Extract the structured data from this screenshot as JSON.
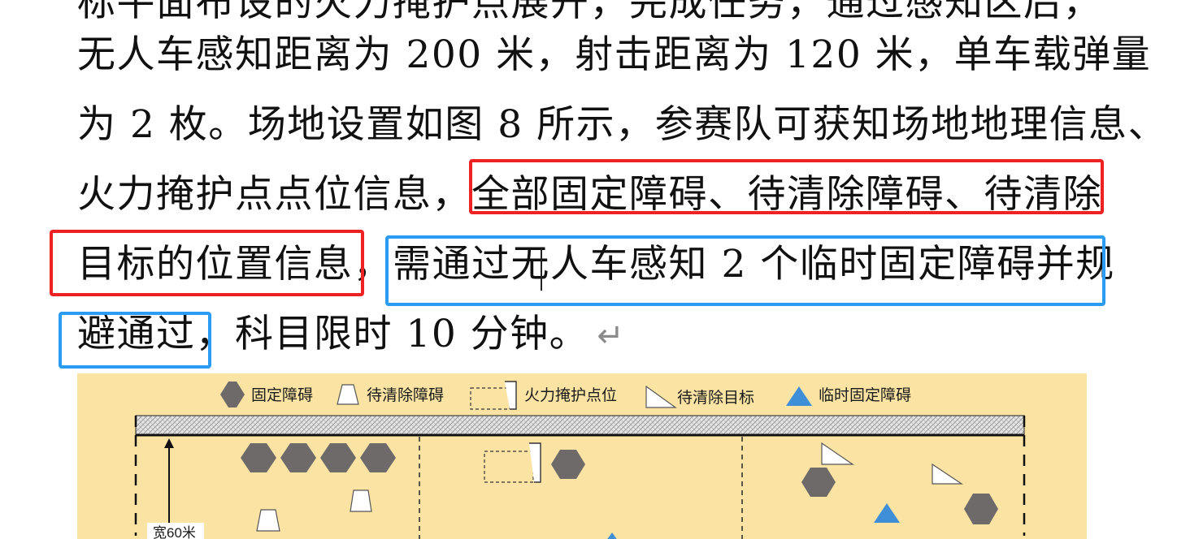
{
  "text": {
    "line_cut": "标平面布设的火力掩护点展开，完成任务，通过感知区后，",
    "line1": "无人车感知距离为 200 米，射击距离为 120 米，单车载弹量",
    "line2": "为 2 枚。场地设置如图 8 所示，参赛队可获知场地地理信息、",
    "line3": "火力掩护点点位信息，全部固定障碍、待清除障碍、待清除",
    "line4": "目标的位置信息，需通过无人车感知 2 个临时固定障碍并规",
    "line5": "避通过，科目限时 10 分钟。",
    "return_mark": "↵"
  },
  "figure": {
    "legend": {
      "fixed_obstacle": "固定障碍",
      "clear_obstacle": "待清除障碍",
      "fire_cover_point": "火力掩护点位",
      "clear_target": "待清除目标",
      "temp_obstacle": "临时固定障碍"
    },
    "width_label": "宽60米"
  },
  "colors": {
    "highlight_red": "#ee2222",
    "highlight_blue": "#2b9cf2",
    "figure_bg": "#fbe4a3",
    "obstacle_gray": "#6f6a6a",
    "triangle_blue": "#3f8fd8"
  }
}
